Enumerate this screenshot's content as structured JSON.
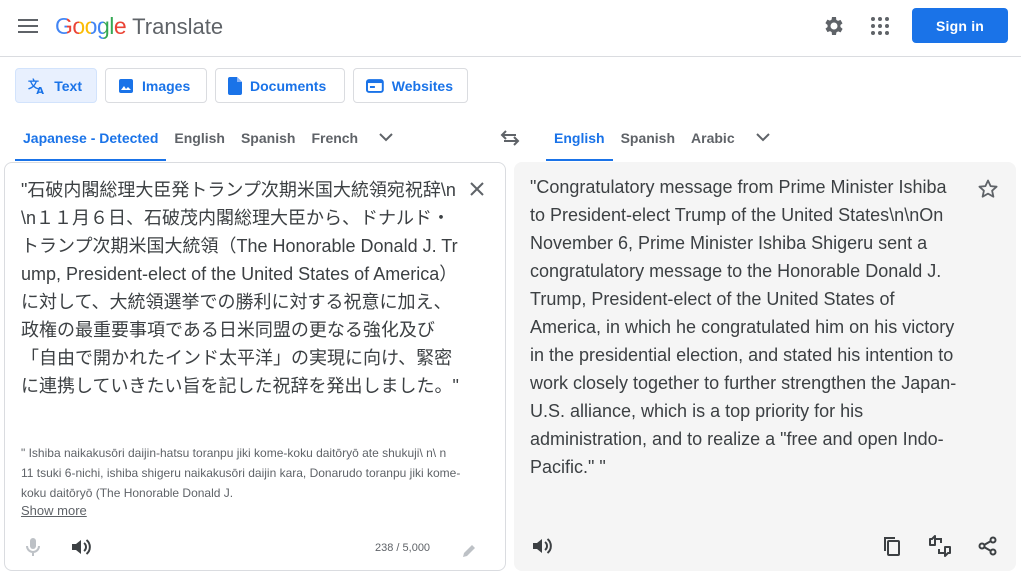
{
  "header": {
    "logo_google": "Google",
    "logo_translate": "Translate",
    "sign_in": "Sign in"
  },
  "modes": [
    {
      "label": "Text",
      "icon": "translate-icon",
      "active": true
    },
    {
      "label": "Images",
      "icon": "image-icon",
      "active": false
    },
    {
      "label": "Documents",
      "icon": "document-icon",
      "active": false
    },
    {
      "label": "Websites",
      "icon": "website-icon",
      "active": false
    }
  ],
  "source_langs": [
    "Japanese - Detected",
    "English",
    "Spanish",
    "French"
  ],
  "target_langs": [
    "English",
    "Spanish",
    "Arabic"
  ],
  "source": {
    "text": "\"石破内閣総理大臣発トランプ次期米国大統領宛祝辞\\n\\n１１月６日、石破茂内閣総理大臣から、ドナルド・トランプ次期米国大統領（The Honorable Donald J. Trump, President-elect of the United States of America）に対して、大統領選挙での勝利に対する祝意に加え、政権の最重要事項である日米同盟の更なる強化及び「自由で開かれたインド太平洋」の実現に向け、緊密に連携していきたい旨を記した祝辞を発出しました。\"",
    "romanized": "\" Ishiba naikakusōri daijin-hatsu toranpu jiki kome-koku daitōryō ate shukuji\\ n\\ n 11 tsuki 6-nichi, ishiba shigeru naikakusōri daijin kara, Donarudo toranpu jiki kome-koku daitōryō (The Honorable Donald J.",
    "show_more": "Show more",
    "char_count": "238 / 5,000"
  },
  "target": {
    "text": "\"Congratulatory message from Prime Minister Ishiba to President-elect Trump of the United States\\n\\nOn November 6, Prime Minister Ishiba Shigeru sent a congratulatory message to the Honorable Donald J. Trump, President-elect of the United States of America, in which he congratulated him on his victory in the presidential election, and stated his intention to work closely together to further strengthen the Japan-U.S. alliance, which is a top priority for his administration, and to realize a \"free and open Indo-Pacific.\" \""
  },
  "colors": {
    "accent": "#1a73e8",
    "muted": "#5f6368",
    "panel": "#f5f5f5"
  }
}
